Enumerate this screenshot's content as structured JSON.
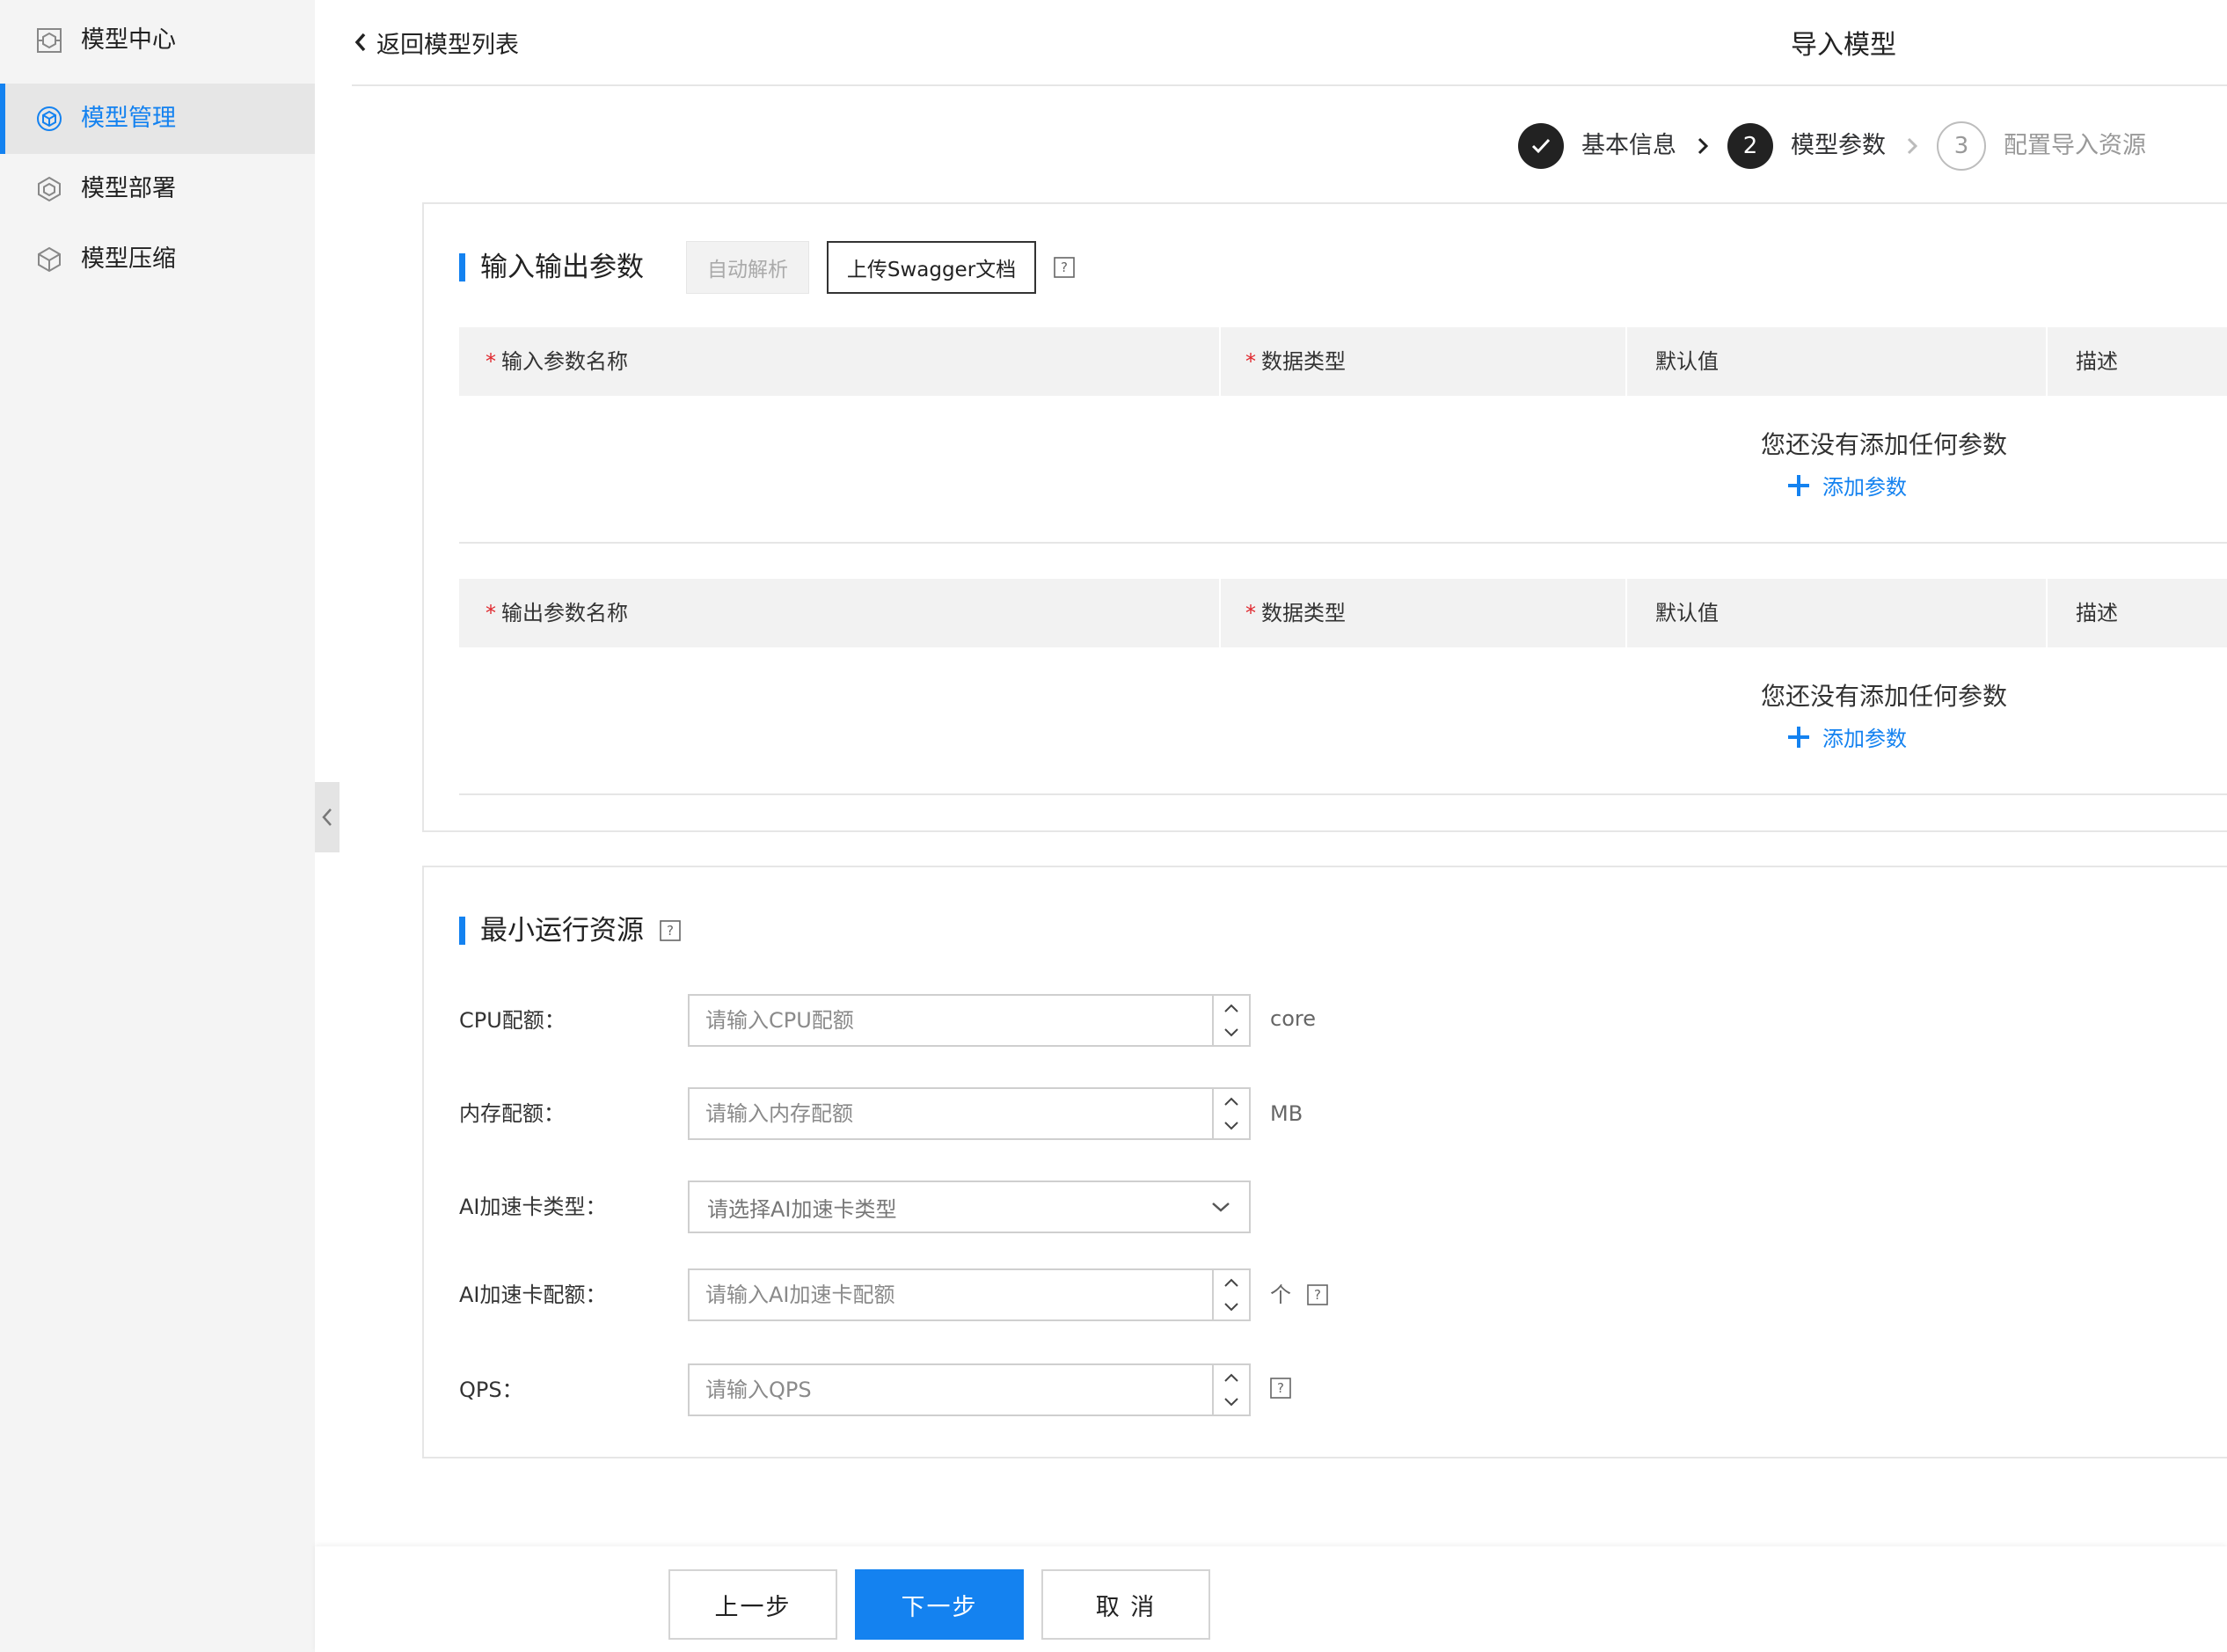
{
  "sidebar": {
    "items": [
      {
        "label": "模型中心",
        "icon": "model-center-icon"
      },
      {
        "label": "模型管理",
        "icon": "model-manage-icon",
        "active": true
      },
      {
        "label": "模型部署",
        "icon": "model-deploy-icon"
      },
      {
        "label": "模型压缩",
        "icon": "model-compress-icon"
      }
    ]
  },
  "header": {
    "back_label": "返回模型列表",
    "title": "导入模型"
  },
  "steps": [
    {
      "number": "1",
      "label": "基本信息",
      "state": "done"
    },
    {
      "number": "2",
      "label": "模型参数",
      "state": "current"
    },
    {
      "number": "3",
      "label": "配置导入资源",
      "state": "todo"
    }
  ],
  "io_section": {
    "title": "输入输出参数",
    "auto_parse_label": "自动解析",
    "upload_label": "上传Swagger文档",
    "input_table": {
      "columns": [
        "输入参数名称",
        "数据类型",
        "默认值",
        "描述"
      ],
      "empty_text": "您还没有添加任何参数",
      "add_label": "添加参数"
    },
    "output_table": {
      "columns": [
        "输出参数名称",
        "数据类型",
        "默认值",
        "描述"
      ],
      "empty_text": "您还没有添加任何参数",
      "add_label": "添加参数"
    }
  },
  "resource_section": {
    "title": "最小运行资源",
    "cpu": {
      "label": "CPU配额：",
      "placeholder": "请输入CPU配额",
      "unit": "core"
    },
    "memory": {
      "label": "内存配额：",
      "placeholder": "请输入内存配额",
      "unit": "MB"
    },
    "ai_card_type": {
      "label": "AI加速卡类型：",
      "placeholder": "请选择AI加速卡类型"
    },
    "ai_card_quota": {
      "label": "AI加速卡配额：",
      "placeholder": "请输入AI加速卡配额",
      "unit": "个"
    },
    "qps": {
      "label": "QPS：",
      "placeholder": "请输入QPS"
    }
  },
  "footer": {
    "prev_label": "上一步",
    "next_label": "下一步",
    "cancel_label": "取 消"
  },
  "colors": {
    "accent": "#1482f0",
    "required": "#e0282e",
    "sidebar_bg": "#f4f4f4"
  }
}
